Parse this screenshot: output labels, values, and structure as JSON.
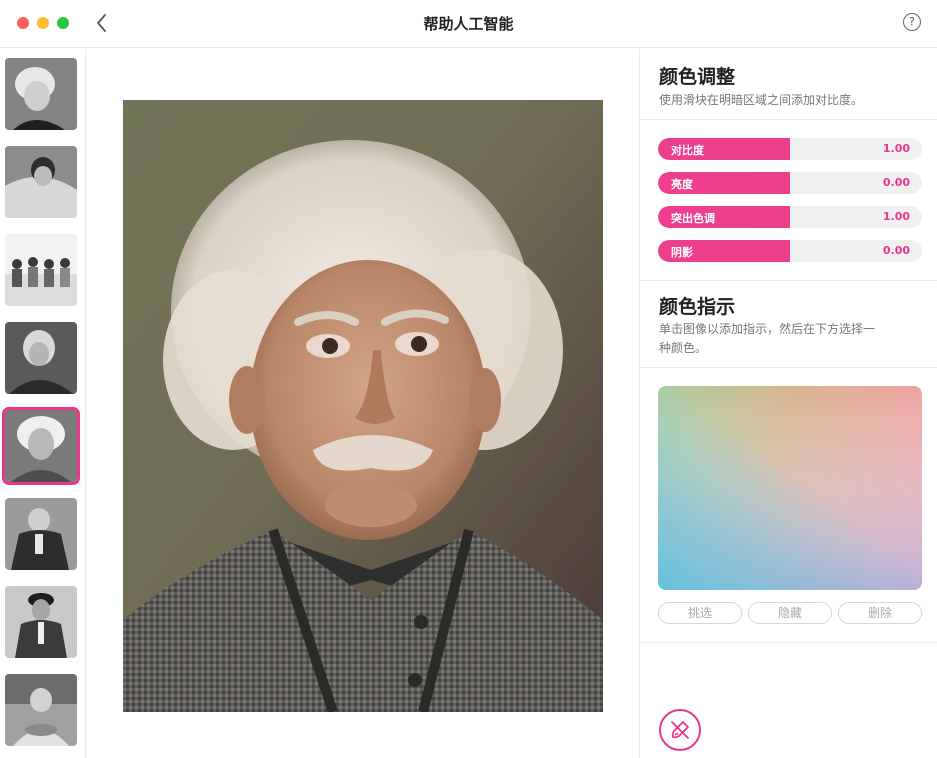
{
  "window": {
    "title": "帮助人工智能",
    "help_glyph": "?"
  },
  "thumbnails": [
    {
      "name": "portrait-1"
    },
    {
      "name": "portrait-2"
    },
    {
      "name": "group-photo"
    },
    {
      "name": "portrait-4"
    },
    {
      "name": "portrait-einstein",
      "selected": true
    },
    {
      "name": "portrait-6"
    },
    {
      "name": "portrait-7"
    },
    {
      "name": "portrait-8"
    }
  ],
  "color_adjust": {
    "title": "颜色调整",
    "subtitle": "使用滑块在明暗区域之间添加对比度。",
    "sliders": [
      {
        "label": "对比度",
        "value": "1.00"
      },
      {
        "label": "亮度",
        "value": "0.00"
      },
      {
        "label": "突出色调",
        "value": "1.00"
      },
      {
        "label": "阴影",
        "value": "0.00"
      }
    ]
  },
  "color_hint": {
    "title": "颜色指示",
    "subtitle_line1": "单击图像以添加指示，然后在下方选择一",
    "subtitle_line2": "种颜色。",
    "buttons": {
      "pick": "挑选",
      "hide": "隐藏",
      "delete": "删除"
    }
  },
  "colors": {
    "accent": "#e9378a"
  },
  "icons": {
    "back": "chevron-left-icon",
    "help": "question-circle-icon",
    "brush": "brush-off-icon"
  }
}
